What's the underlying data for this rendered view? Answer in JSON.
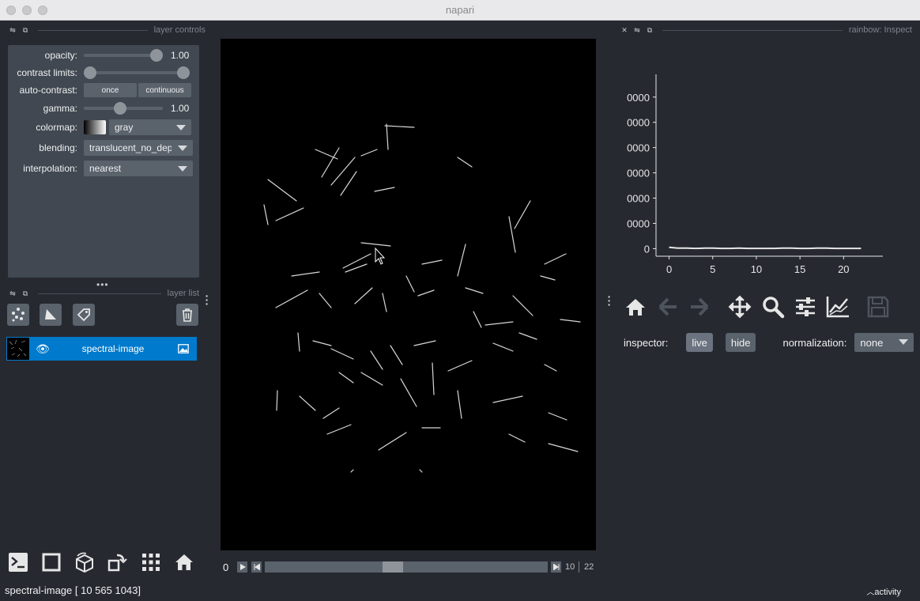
{
  "window": {
    "title": "napari"
  },
  "layer_controls": {
    "header": "layer controls",
    "opacity": {
      "label": "opacity:",
      "value": "1.00",
      "level": 1.0
    },
    "contrast_limits": {
      "label": "contrast limits:",
      "low": 0.0,
      "high": 1.0
    },
    "auto_contrast": {
      "label": "auto-contrast:",
      "once": "once",
      "continuous": "continuous"
    },
    "gamma": {
      "label": "gamma:",
      "value": "1.00",
      "level": 0.45
    },
    "colormap": {
      "label": "colormap:",
      "value": "gray"
    },
    "blending": {
      "label": "blending:",
      "value": "translucent_no_depth"
    },
    "interpolation": {
      "label": "interpolation:",
      "value": "nearest"
    }
  },
  "layer_list": {
    "header": "layer list",
    "buttons": [
      "points-icon",
      "shapes-icon",
      "labels-icon",
      "delete-icon"
    ],
    "layers": [
      {
        "name": "spectral-image",
        "visible": true,
        "type_icon": "image-icon"
      }
    ]
  },
  "bottom_buttons": [
    "console-icon",
    "2d-3d-toggle-icon",
    "3d-cube-icon",
    "transpose-icon",
    "grid-icon",
    "home-icon"
  ],
  "dims": {
    "current": "0",
    "slider_level": 0.45,
    "value": "10",
    "max": "22"
  },
  "status_bar": {
    "text": "spectral-image [  10  565 1043]",
    "activity": "activity"
  },
  "inspect_panel": {
    "header": "rainbow: Inspect",
    "toolbar": [
      "home-icon",
      "back-arrow-icon",
      "forward-arrow-icon",
      "pan-icon",
      "zoom-icon",
      "configure-icon",
      "edit-curve-icon",
      "save-icon"
    ],
    "inspector_label": "inspector:",
    "live": "live",
    "hide": "hide",
    "normalization_label": "normalization:",
    "normalization_value": "none"
  },
  "chart_data": {
    "type": "line",
    "xticks": [
      "0",
      "5",
      "10",
      "15",
      "20"
    ],
    "yticks": [
      "0",
      "0000",
      "0000",
      "0000",
      "0000",
      "0000",
      "0000"
    ],
    "x": [
      0,
      1,
      2,
      3,
      4,
      5,
      6,
      7,
      8,
      9,
      10,
      11,
      12,
      13,
      14,
      15,
      16,
      17,
      18,
      19,
      20,
      21,
      22
    ],
    "values": [
      0.05,
      0.02,
      0.02,
      0.01,
      0.02,
      0.02,
      0.01,
      0.01,
      0.02,
      0.01,
      0.01,
      0.01,
      0.01,
      0.02,
      0.02,
      0.01,
      0.01,
      0.02,
      0.02,
      0.01,
      0.01,
      0.01,
      0.01
    ],
    "xlim": [
      -1.5,
      24.5
    ],
    "ylim": [
      -0.3,
      6.9
    ],
    "color": "#e6e6e6"
  },
  "colors": {
    "accent": "#007acc",
    "background": "#262930",
    "panel": "#414851",
    "button": "#5a626c"
  }
}
